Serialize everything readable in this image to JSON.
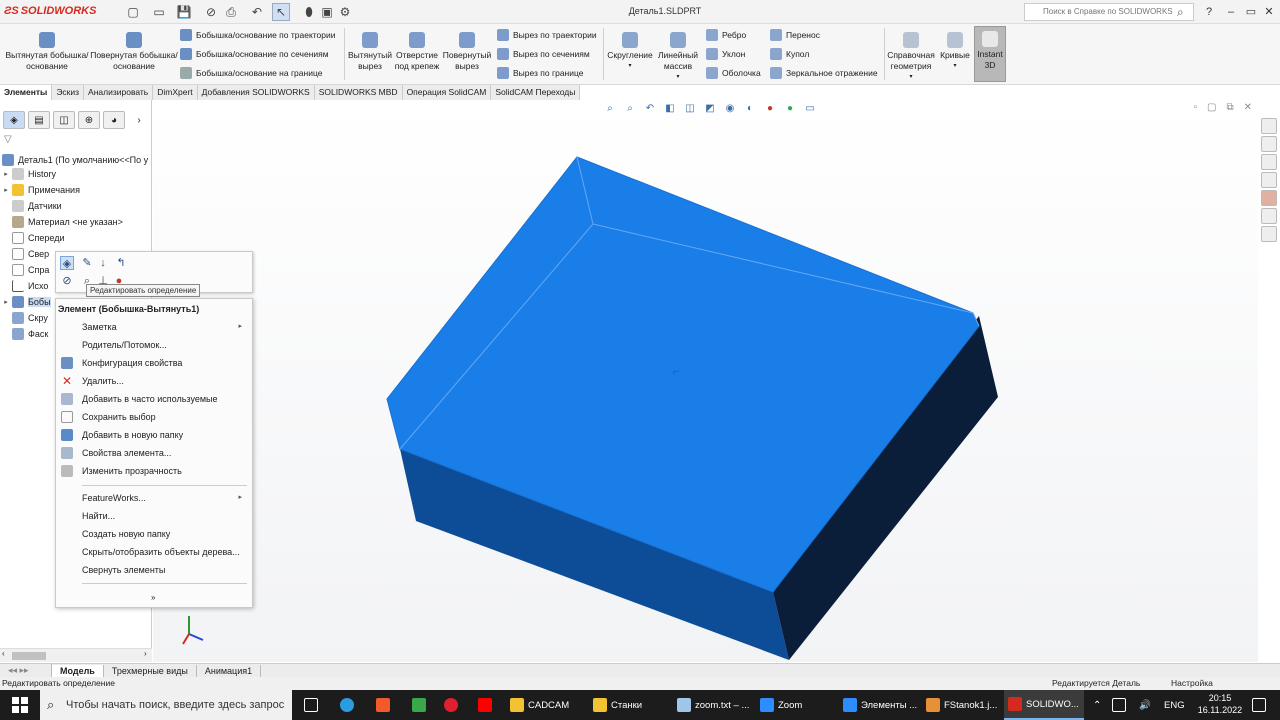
{
  "app": {
    "logo": "SOLIDWORKS",
    "doc_title": "Деталь1.SLDPRT",
    "help_search_placeholder": "Поиск в Справке по SOLIDWORKS"
  },
  "ribbon": {
    "extrude_boss": "Вытянутая бобышка/основание",
    "revolve_boss": "Повернутая бобышка/основание",
    "sweep_boss": "Бобышка/основание по траектории",
    "loft_boss": "Бобышка/основание по сечениям",
    "boundary_boss": "Бобышка/основание на границе",
    "extrude_cut": "Вытянутый вырез",
    "hole": "Отверстие под крепеж",
    "revolve_cut": "Повернутый вырез",
    "sweep_cut": "Вырез по траектории",
    "loft_cut": "Вырез по сечениям",
    "boundary_cut": "Вырез по границе",
    "fillet": "Скругление",
    "linear_pattern": "Линейный массив",
    "rib": "Ребро",
    "draft": "Уклон",
    "shell": "Оболочка",
    "wrap": "Перенос",
    "dome": "Купол",
    "mirror": "Зеркальное отражение",
    "ref_geometry": "Справочная геометрия",
    "curves": "Кривые",
    "instant3d": "Instant 3D"
  },
  "cmd_tabs": [
    "Элементы",
    "Эскиз",
    "Анализировать",
    "DimXpert",
    "Добавления SOLIDWORKS",
    "SOLIDWORKS MBD",
    "Операция  SolidCAM",
    "SolidCAM Переходы"
  ],
  "tree": {
    "root": "Деталь1  (По умолчанию<<По у",
    "items": [
      "History",
      "Примечания",
      "Датчики",
      "Материал <не указан>",
      "Спереди",
      "Свер",
      "Спра",
      "Исхо",
      "Бобы",
      "Скру",
      "Фаск"
    ]
  },
  "tooltip": "Редактировать определение",
  "context_menu": {
    "header": "Элемент (Бобышка-Вытянуть1)",
    "items": [
      "Заметка",
      "Родитель/Потомок...",
      "Конфигурация свойства",
      "Удалить...",
      "Добавить в часто используемые",
      "Сохранить выбор",
      "Добавить в новую папку",
      "Свойства элемента...",
      "Изменить прозрачность"
    ],
    "items2": [
      "FeatureWorks...",
      "Найти...",
      "Создать новую папку",
      "Скрыть/отобразить объекты дерева...",
      "Свернуть элементы"
    ],
    "more": "»"
  },
  "model_tabs": [
    "Модель",
    "Трехмерные виды",
    "Анимация1"
  ],
  "status": {
    "left": "Редактировать определение",
    "editing": "Редактируется Деталь",
    "settings": "Настройка"
  },
  "taskbar": {
    "search_placeholder": "Чтобы начать поиск, введите здесь запрос",
    "apps": [
      "CADCAM",
      "Станки",
      "zoom.txt – ...",
      "Zoom",
      "Элементы ...",
      "FStanok1.j...",
      "SOLIDWO..."
    ],
    "lang": "ENG",
    "time": "20:15",
    "date": "16.11.2022"
  },
  "colors": {
    "brand_red": "#d52b1e",
    "box_top": "#1a7ee8",
    "box_side_front": "#0d4d97",
    "box_side_right": "#0a1e3a"
  }
}
